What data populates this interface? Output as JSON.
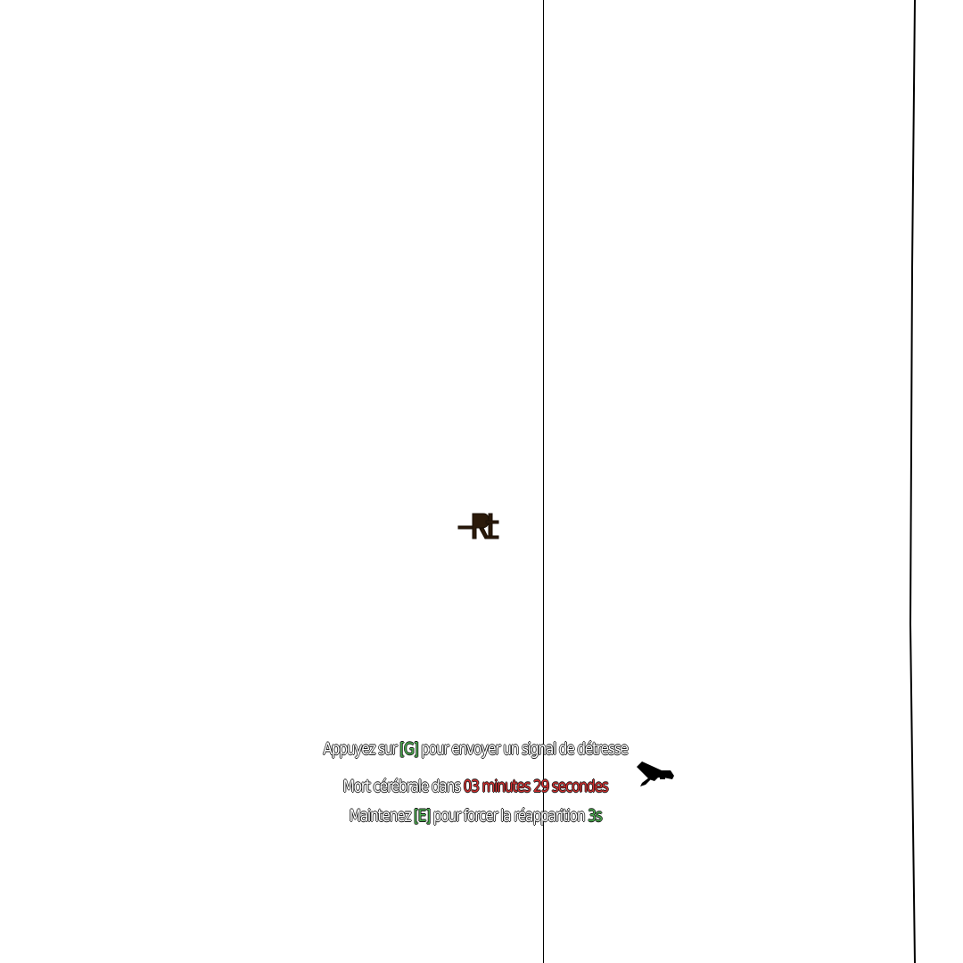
{
  "hud": {
    "distress": {
      "before": "Appuyez sur ",
      "key": "[G]",
      "after": " pour envoyer un signal de détresse"
    },
    "death": {
      "before": "Mort cérébrale dans ",
      "timer": "03 minutes 29 secondes"
    },
    "respawn": {
      "before": "Maintenez ",
      "key": "[E]",
      "middle": " pour forcer la réapparition ",
      "countdown": "3s"
    },
    "icons": {
      "crosshair": "downed-marker-icon",
      "flare": "flare-gun-icon"
    },
    "colors": {
      "key": "#4caf50",
      "timer": "#d32f2f",
      "text": "#ffffff",
      "outline": "#1a1a1a"
    }
  }
}
